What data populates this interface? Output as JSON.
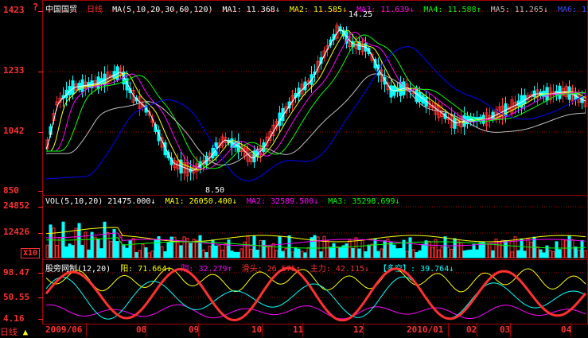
{
  "app": {
    "title_icon": "question-mark-icon"
  },
  "header": {
    "stock_name": "中国国贸",
    "period": "日线",
    "ma_label": "MA(5,10,20,30,60,120)",
    "ma1": "MA1: 11.368↓",
    "ma2": "MA2: 11.585↓",
    "ma3": "MA3: 11.639↓",
    "ma4": "MA4: 11.588↑",
    "ma5": "MA5: 11.265↓",
    "ma6": "MA6: 11.8"
  },
  "price_axis": {
    "labels": [
      "1423",
      "1233",
      "1042",
      "850"
    ],
    "high_mark": "14.25",
    "low_mark": "8.50"
  },
  "volume": {
    "header": "VOL(5,10,20) 21475.000↓",
    "ma1": "MA1: 26050.400↓",
    "ma2": "MA2: 32589.500↓",
    "ma3": "MA3: 35298.699↓",
    "axis_labels": [
      "24852",
      "12426"
    ],
    "multiplier": "X10"
  },
  "indicator": {
    "name": "股旁网制(12,20)",
    "yang": "阳: 71.664↓",
    "yin": "阴: 32.279↑",
    "longhead": "滑头: 26.575↑",
    "main": "主力: 42.115↓",
    "duokong": "【多空】: 39.764↓",
    "axis_labels": [
      "98.47",
      "50.55",
      "4.16"
    ]
  },
  "time_axis": {
    "labels": [
      "2009/06",
      "08",
      "09",
      "10",
      "11",
      "12",
      "2010/01",
      "02",
      "03",
      "04"
    ]
  },
  "bottom": {
    "period_tab": "日线"
  },
  "colors": {
    "up": "#ff3030",
    "down": "#00ffff",
    "ma1": "#ffffff",
    "ma2": "#ffff00",
    "ma3": "#ff00ff",
    "ma4": "#00ff00",
    "ma5": "#c0c0c0",
    "ma6": "#0000ff",
    "grid": "#a00000"
  }
}
